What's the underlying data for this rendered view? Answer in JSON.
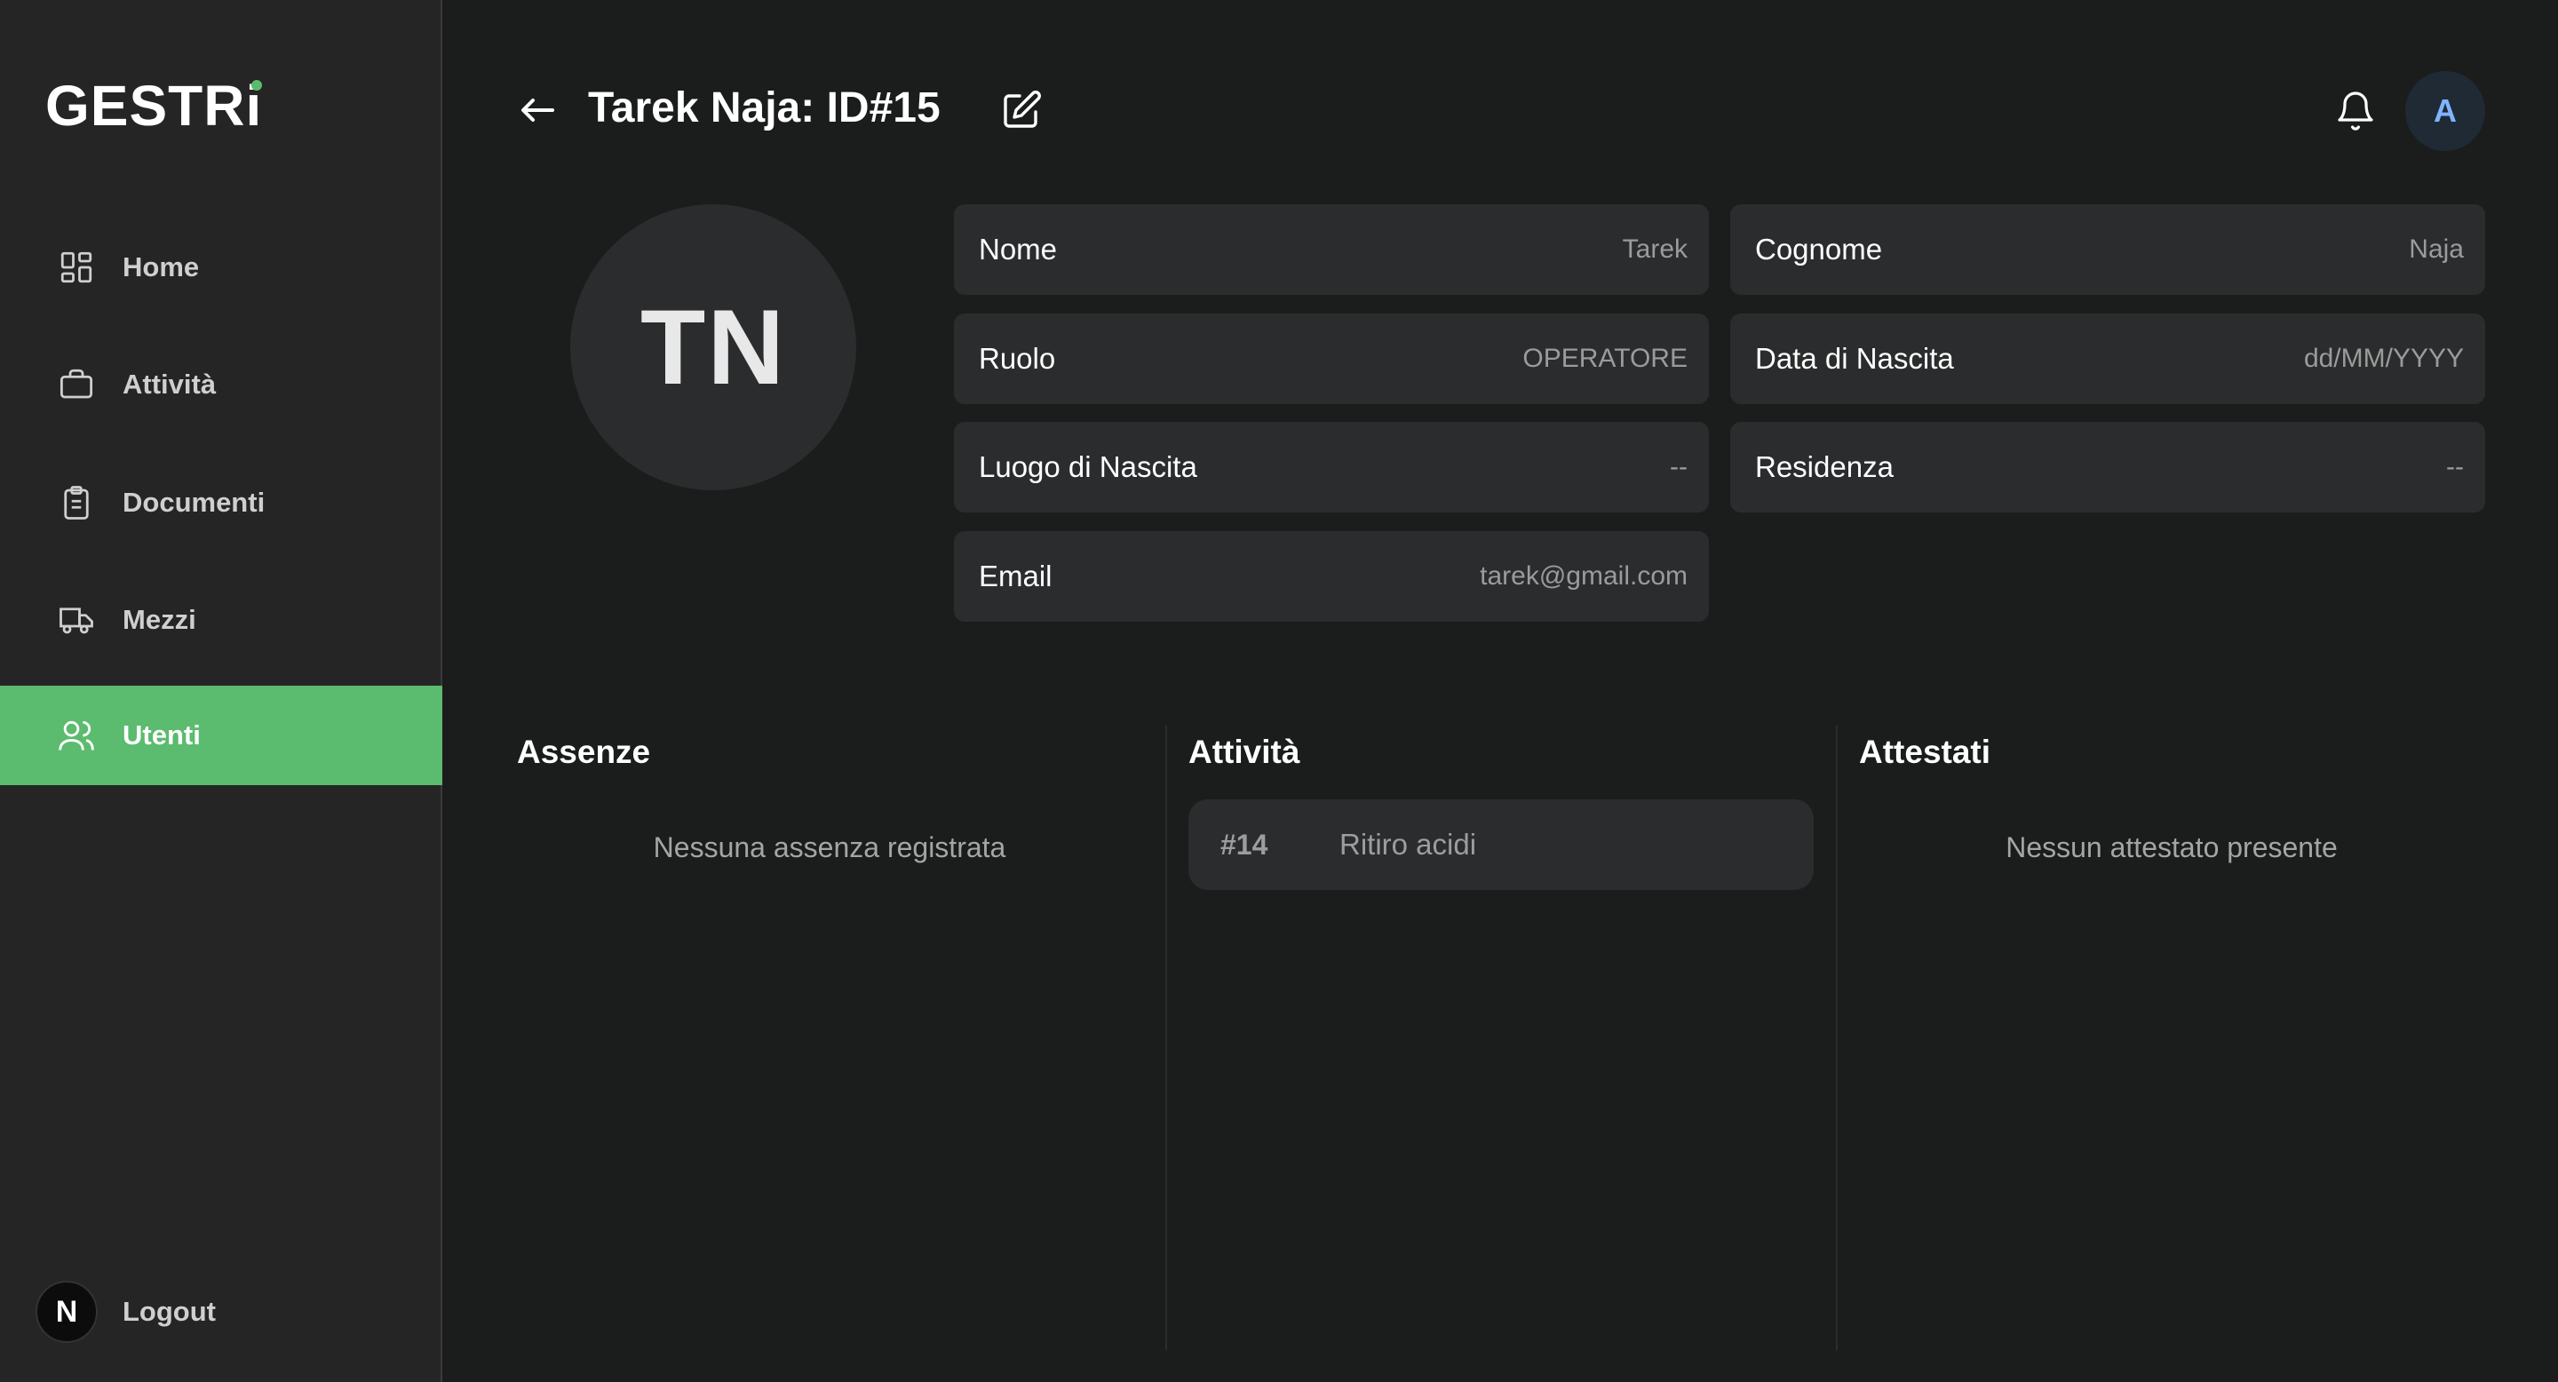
{
  "app": {
    "logo": "GESTRi"
  },
  "sidebar": {
    "items": [
      {
        "label": "Home",
        "icon": "dashboard-icon"
      },
      {
        "label": "Attività",
        "icon": "briefcase-icon"
      },
      {
        "label": "Documenti",
        "icon": "clipboard-icon"
      },
      {
        "label": "Mezzi",
        "icon": "truck-icon"
      },
      {
        "label": "Utenti",
        "icon": "users-icon",
        "active": true
      }
    ],
    "logout": {
      "badge": "N",
      "label": "Logout"
    }
  },
  "header": {
    "title": "Tarek Naja: ID#15",
    "user_initial": "A"
  },
  "profile": {
    "initials": "TN",
    "fields": {
      "nome": {
        "label": "Nome",
        "value": "Tarek"
      },
      "cognome": {
        "label": "Cognome",
        "value": "Naja"
      },
      "ruolo": {
        "label": "Ruolo",
        "value": "OPERATORE"
      },
      "data_nascita": {
        "label": "Data di Nascita",
        "value": "dd/MM/YYYY"
      },
      "luogo_nascita": {
        "label": "Luogo di Nascita",
        "value": "--"
      },
      "residenza": {
        "label": "Residenza",
        "value": "--"
      },
      "email": {
        "label": "Email",
        "value": "tarek@gmail.com"
      }
    }
  },
  "sections": {
    "assenze": {
      "title": "Assenze",
      "empty": "Nessuna assenza registrata"
    },
    "attivita": {
      "title": "Attività",
      "items": [
        {
          "id": "#14",
          "name": "Ritiro acidi"
        }
      ]
    },
    "attestati": {
      "title": "Attestati",
      "empty": "Nessun attestato presente"
    }
  },
  "colors": {
    "accent": "#5bbb6e",
    "background": "#1b1c1c",
    "sidebar": "#252525",
    "card": "#2b2c2d"
  }
}
